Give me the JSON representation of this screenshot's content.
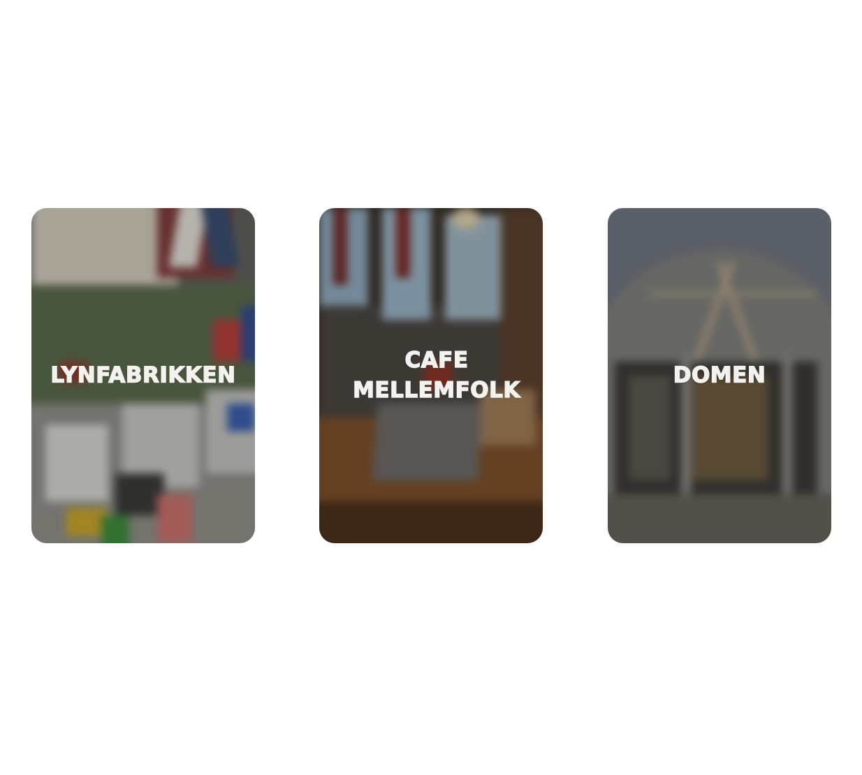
{
  "cards": [
    {
      "label": "LYNFABRIKKEN"
    },
    {
      "label": "CAFE MELLEMFOLK"
    },
    {
      "label": "DOMEN"
    }
  ],
  "colors": {
    "background": "#ffffff",
    "label_text": "#f4f2ee"
  }
}
